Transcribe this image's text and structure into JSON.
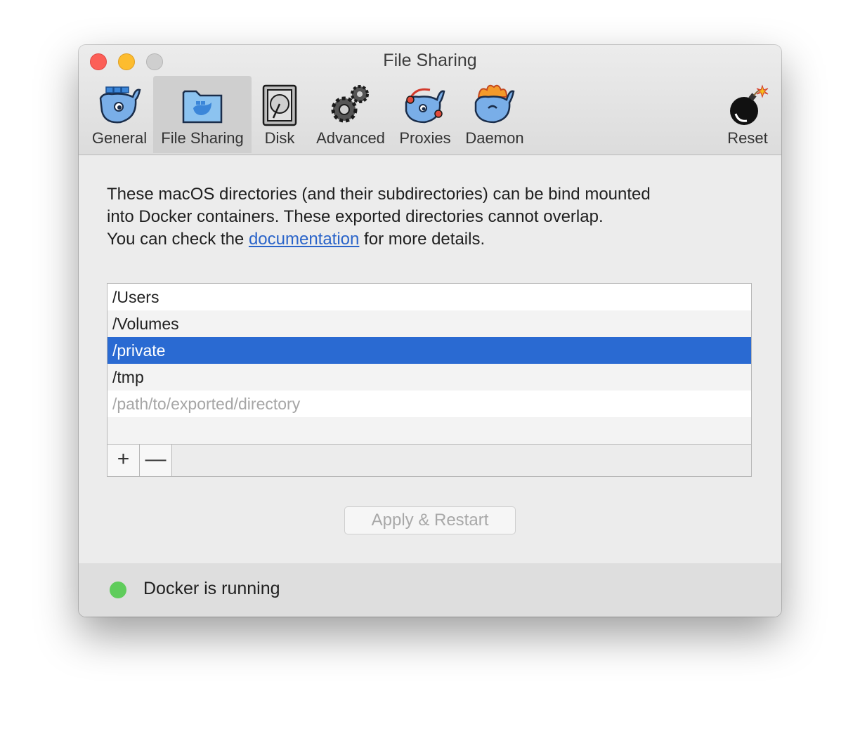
{
  "window": {
    "title": "File Sharing"
  },
  "toolbar": {
    "items": [
      {
        "label": "General",
        "icon": "whale-icon"
      },
      {
        "label": "File Sharing",
        "icon": "folder-whale-icon"
      },
      {
        "label": "Disk",
        "icon": "disk-icon"
      },
      {
        "label": "Advanced",
        "icon": "gears-icon"
      },
      {
        "label": "Proxies",
        "icon": "headphones-whale-icon"
      },
      {
        "label": "Daemon",
        "icon": "fire-whale-icon"
      },
      {
        "label": "Reset",
        "icon": "bomb-icon"
      }
    ],
    "selected": "File Sharing"
  },
  "description": {
    "line1": "These macOS directories (and their subdirectories) can be bind mounted",
    "line2": "into Docker containers. These exported directories cannot overlap.",
    "line3_before": "You can check the ",
    "link": "documentation",
    "line3_after": " for more details."
  },
  "directories": {
    "items": [
      "/Users",
      "/Volumes",
      "/private",
      "/tmp"
    ],
    "selected": "/private",
    "placeholder": "/path/to/exported/directory",
    "add_label": "+",
    "remove_label": "—"
  },
  "apply_button": "Apply & Restart",
  "status": {
    "text": "Docker is running",
    "color": "#5fcc5b"
  },
  "colors": {
    "selection": "#2a6ad2",
    "link": "#2a64c9"
  }
}
